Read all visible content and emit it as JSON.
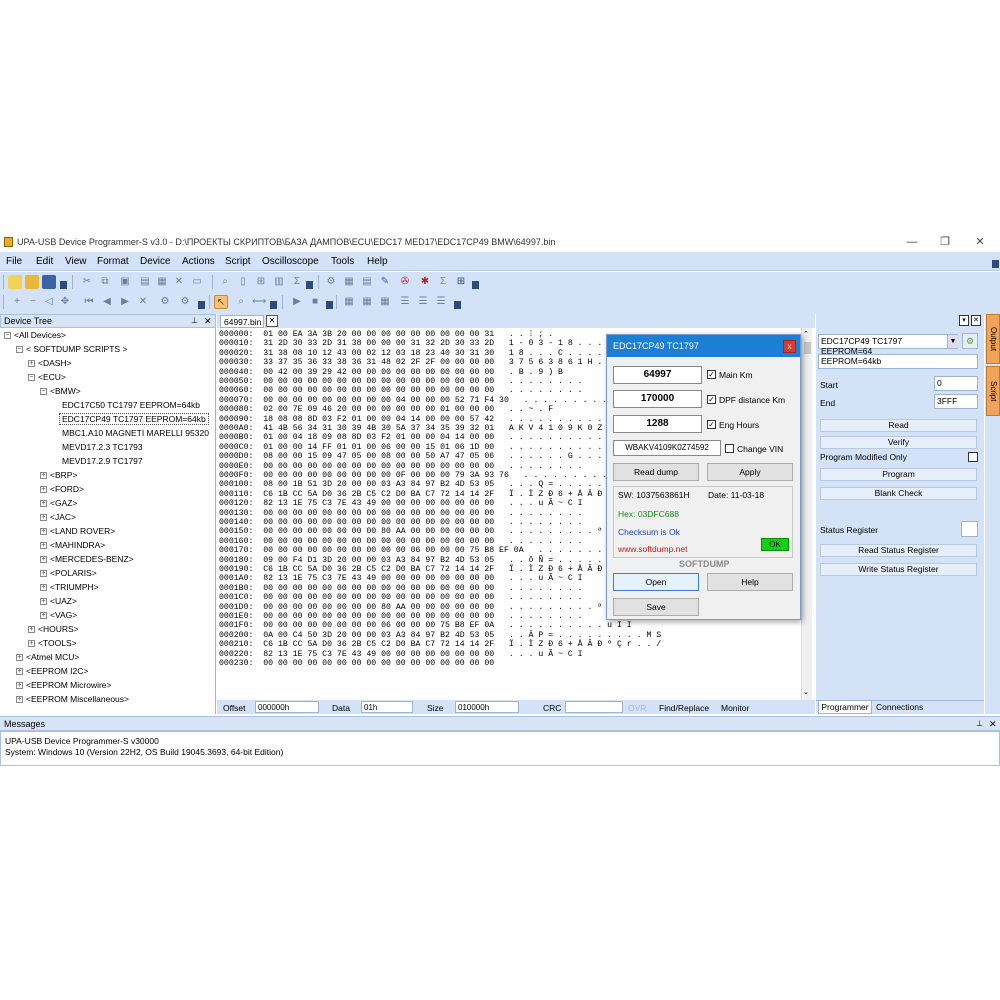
{
  "window": {
    "title": "UPA-USB Device Programmer-S v3.0 - D:\\ПРОЕКТЫ СКРИПТОВ\\БАЗА ДАМПОВ\\ECU\\EDC17 MED17\\EDC17CP49 BMW\\64997.bin",
    "min": "—",
    "max": "❐",
    "close": "✕"
  },
  "menu": [
    "File",
    "Edit",
    "View",
    "Format",
    "Device",
    "Actions",
    "Script",
    "Oscilloscope",
    "Tools",
    "Help"
  ],
  "device_tree": {
    "title": "Device Tree",
    "pin": "📌",
    "close": "✕",
    "items": [
      {
        "label": "<All Devices>",
        "sign": "⊟"
      },
      {
        "label": "< SOFTDUMP SCRIPTS >",
        "sign": "⊟"
      },
      {
        "label": "<DASH>",
        "sign": "⊞"
      },
      {
        "label": "<ECU>",
        "sign": "⊟"
      },
      {
        "label": "<BMW>",
        "sign": "⊟"
      },
      {
        "label": "EDC17C50 TC1797 EEPROM=64kb",
        "sign": ""
      },
      {
        "label": "EDC17CP49 TC1797 EEPROM=64kb",
        "sign": ""
      },
      {
        "label": "MBC1.A10 MAGNETI MARELLI 95320",
        "sign": ""
      },
      {
        "label": "MEVD17.2.3 TC1793",
        "sign": ""
      },
      {
        "label": "MEVD17.2.9 TC1797",
        "sign": ""
      },
      {
        "label": "<BRP>",
        "sign": "⊞"
      },
      {
        "label": "<FORD>",
        "sign": "⊞"
      },
      {
        "label": "<GAZ>",
        "sign": "⊞"
      },
      {
        "label": "<JAC>",
        "sign": "⊞"
      },
      {
        "label": "<LAND ROVER>",
        "sign": "⊞"
      },
      {
        "label": "<MAHINDRA>",
        "sign": "⊞"
      },
      {
        "label": "<MERCEDES-BENZ>",
        "sign": "⊞"
      },
      {
        "label": "<POLARIS>",
        "sign": "⊞"
      },
      {
        "label": "<TRIUMPH>",
        "sign": "⊞"
      },
      {
        "label": "<UAZ>",
        "sign": "⊞"
      },
      {
        "label": "<VAG>",
        "sign": "⊞"
      },
      {
        "label": "<HOURS>",
        "sign": "⊞"
      },
      {
        "label": "<TOOLS>",
        "sign": "⊞"
      },
      {
        "label": "<Atmel MCU>",
        "sign": "⊞"
      },
      {
        "label": "<EEPROM I2C>",
        "sign": "⊞"
      },
      {
        "label": "<EEPROM Microwire>",
        "sign": "⊞"
      },
      {
        "label": "<EEPROM Miscellaneous>",
        "sign": "⊞"
      }
    ]
  },
  "file_tab": {
    "label": "64997.bin",
    "close": "✕"
  },
  "hex_rows": [
    "000000:  01 00 EA 3A 3B 20 00 00 00 00 00 00 00 00 00 31   . . ⁞ ; .",
    "000010:  31 2D 30 33 2D 31 38 00 00 00 31 32 2D 30 33 2D   1 - 0 3 - 1 8 . . . . 1 2 - 0",
    "000020:  31 38 08 10 12 43 00 02 12 03 18 23 40 30 31 30   1 8 . . . C . . . . . # @0",
    "000030:  33 37 35 36 33 38 36 31 48 02 2F 2F 00 00 00 00   3 7 5 6 3 8 6 1 H . / / . .",
    "000040:  00 42 00 39 29 42 00 00 00 00 00 00 00 00 00 00   . B . 9 ) B",
    "000050:  00 00 00 00 00 00 00 00 00 00 00 00 00 00 00 00   . . . . . . . .",
    "000060:  00 00 00 00 00 00 00 00 00 00 00 00 00 00 00 00   . . . . . . . .",
    "000070:  00 00 00 00 00 00 00 00 00 04 00 00 00 52 71 F4 30   . . . . . . . . . . . . . R q",
    "000080:  02 00 7E 09 46 20 00 00 00 00 00 00 01 00 00 00   . . ~ . F",
    "000090:  18 08 08 8D 03 F2 01 00 00 04 14 00 00 00 57 42   . . . . . . . . . . . . . . W",
    "0000A0:  41 4B 56 34 31 30 39 4B 30 5A 37 34 35 39 32 01   A K V 4 1 0 9 K 0 Z 7 4 5 9",
    "0000B0:  01 00 04 18 09 08 8D 03 F2 01 00 00 04 14 00 00   . . . . . . . . . . . . . .",
    "0000C0:  01 00 00 14 FF 01 01 00 06 00 00 15 01 06 1D 00   . . . . . . . . . . . . . .",
    "0000D0:  08 00 00 15 09 47 05 00 08 00 00 50 A7 47 05 06   . . . . . . G . . . . . P S G",
    "0000E0:  00 00 00 00 00 00 00 00 00 00 00 00 00 00 00 00   . . . . . . . .",
    "0000F0:  00 00 00 00 00 00 00 00 00 0F 00 00 00 79 3A 93 76   . . . . . . . . . y",
    "000100:  08 00 1B 51 3D 20 00 00 03 A3 84 97 B2 4D 53 05   . . . Q = . . . . . . . . M",
    "000110:  C6 1B CC 5A D0 36 2B C5 C2 D0 BA C7 72 14 14 2F   Ï . Ì Z Ð 6 + Å Â Ð º Ç r . . /",
    "000120:  82 13 1E 75 C3 7E 43 49 00 00 00 00 00 00 00 00   . . . u Ã ~ C I",
    "000130:  00 00 00 00 00 00 00 00 00 00 00 00 00 00 00 00   . . . . . . . .",
    "000140:  00 00 00 00 00 00 00 00 00 00 00 00 00 00 00 00   . . . . . . . .",
    "000150:  00 00 00 00 00 00 00 00 80 AA 00 00 00 00 00 00   . . . . . . . . . ª",
    "000160:  00 00 00 00 00 00 00 00 00 00 00 00 00 00 00 00   . . . . . . . .",
    "000170:  00 00 00 00 00 00 00 00 00 00 06 00 00 00 75 B8 EF 0A   . . . . . . . . . . u I",
    "000180:  09 00 F4 D1 3D 20 00 00 03 A3 84 97 B2 4D 53 05   . . ô Ñ = . . . . . . . M",
    "000190:  C6 1B CC 5A D0 36 2B C5 C2 D0 BA C7 72 14 14 2F   Ï . Ì Z Ð 6 + Å Â Ð º Ç r . . /",
    "0001A0:  82 13 1E 75 C3 7E 43 49 00 00 00 00 00 00 00 00   . . . u Ã ~ C I",
    "0001B0:  00 00 00 00 00 00 00 00 00 00 00 00 00 00 00 00   . . . . . . . .",
    "0001C0:  00 00 00 00 00 00 00 00 00 00 00 00 00 00 00 00   . . . . . . . .",
    "0001D0:  00 00 00 00 00 00 00 00 80 AA 00 00 00 00 00 00   . . . . . . . . . ª",
    "0001E0:  00 00 00 00 00 00 00 00 00 00 00 00 00 00 00 00   . . . . . . . .",
    "0001F0:  00 00 00 00 00 00 00 00 06 00 00 00 75 B8 EF 0A   . . . . . . . . . . u I I",
    "000200:  0A 00 C4 50 3D 20 00 00 03 A3 84 97 B2 4D 53 05   . . Ä P = . . . . . . . . . M S",
    "000210:  C6 1B CC 5A D0 36 2B C5 C2 D0 BA C7 72 14 14 2F   Ï . Ì Z Ð 6 + Å Â Ð º Ç r . . /",
    "000220:  82 13 1E 75 C3 7E 43 49 00 00 00 00 00 00 00 00   . . . u Ã ~ C I",
    "000230:  00 00 00 00 00 00 00 00 00 00 00 00 00 00 00 00"
  ],
  "status_bar": {
    "offset_label": "Offset",
    "offset_value": "000000h",
    "data_label": "Data",
    "data_value": "01h",
    "size_label": "Size",
    "size_value": "010000h",
    "crc_label": "CRC",
    "crc_value": "",
    "ovr": "OVR",
    "find_replace": "Find/Replace",
    "monitor": "Monitor"
  },
  "dialog": {
    "title": "EDC17CP49 TC1797",
    "close": "x",
    "main_km_value": "64997",
    "main_km_label": "Main Km",
    "dpf_value": "170000",
    "dpf_label": "DPF distance Km",
    "eng_hours_value": "1288",
    "eng_hours_label": "Eng Hours",
    "vin_value": "WBAKV4109K0Z74592",
    "change_vin_label": "Change VIN",
    "read_dump": "Read dump",
    "apply": "Apply",
    "sw": "SW: 1037563861H",
    "date": "Date: 11-03-18",
    "hex": "Hex: 03DFC688",
    "checksum": "Checksum is Ok",
    "url": "www.softdump.net",
    "ok_badge": "OK",
    "brand": "SOFTDUMP",
    "open": "Open",
    "help": "Help",
    "save": "Save",
    "check_mark": "✓",
    "colors": {
      "title_bg": "#1c7fd6",
      "hex_text": "#1a8a1a",
      "checksum_text": "#1a3fbf",
      "url_text": "#c0201a",
      "ok_bg": "#12d312"
    }
  },
  "right_panel": {
    "device_select": "EDC17CP49 TC1797 EEPROM=64",
    "eeprom_field": "EEPROM=64kb",
    "start_label": "Start",
    "start_value": "0",
    "end_label": "End",
    "end_value": "3FFF",
    "read": "Read",
    "verify": "Verify",
    "program_modified_only": "Program Modified Only",
    "program": "Program",
    "blank_check": "Blank Check",
    "status_register": "Status Register",
    "read_status_register": "Read Status Register",
    "write_status_register": "Write Status Register",
    "tab_programmer": "Programmer",
    "tab_connections": "Connections",
    "side_output": "Output",
    "side_script": "Script"
  },
  "messages": {
    "title": "Messages",
    "lines": [
      "UPA-USB Device Programmer-S v30000",
      "System: Windows 10 (Version 22H2, OS Build 19045.3693, 64-bit Edition)"
    ]
  }
}
